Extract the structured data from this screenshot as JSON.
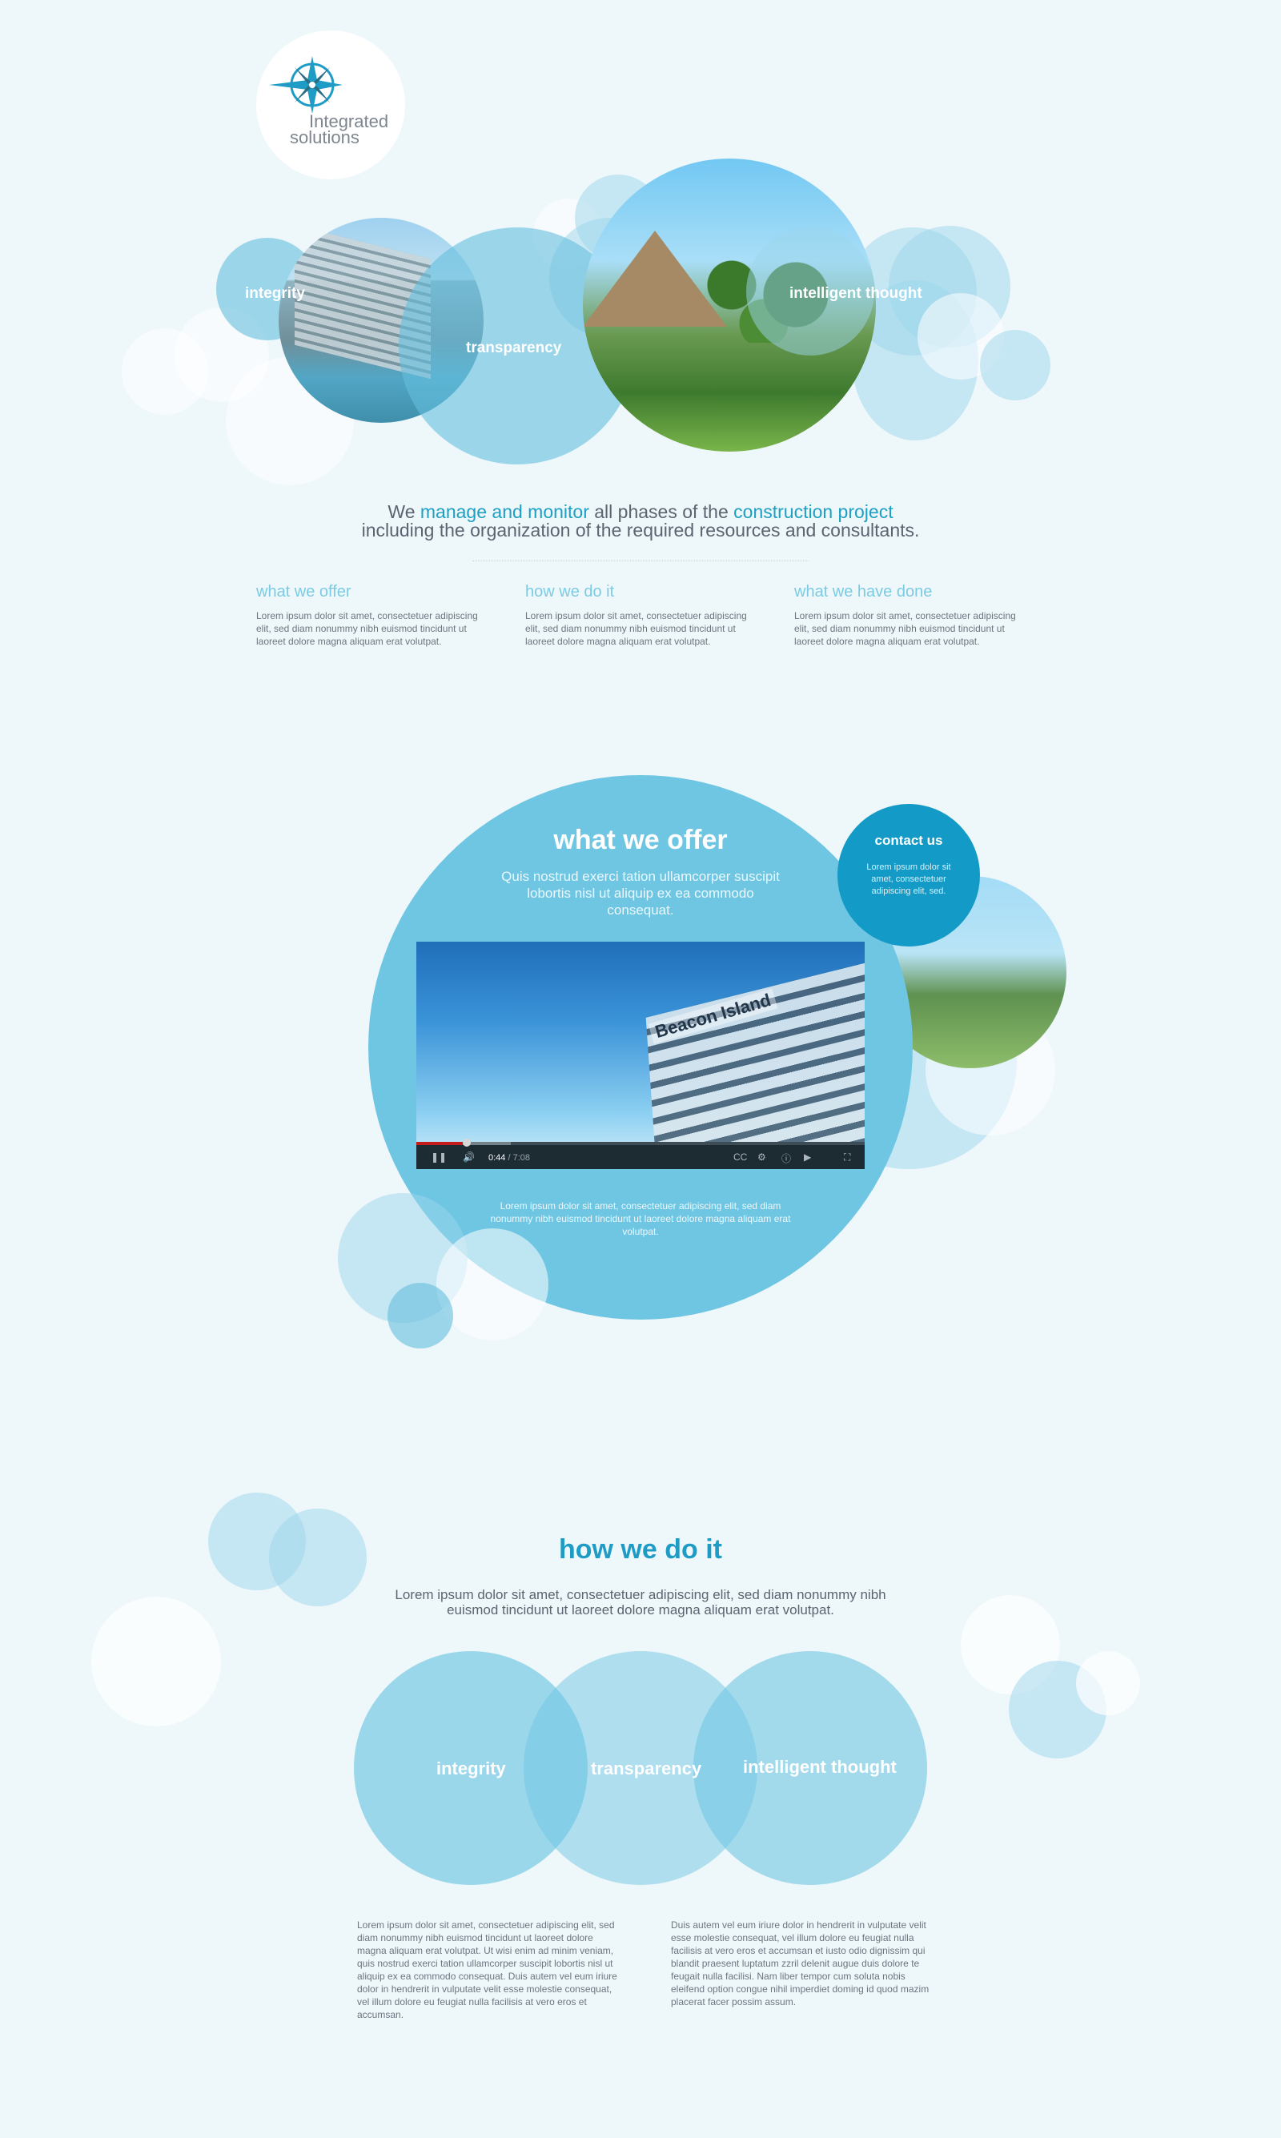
{
  "brand": {
    "name_line1": "Integrated",
    "name_line2": "solutions",
    "logo_icon": "compass-rose-icon"
  },
  "hero": {
    "labels": {
      "integrity": "integrity",
      "transparency": "transparency",
      "intelligent": "intelligent thought"
    },
    "tagline": {
      "p1": "We ",
      "h1": "manage and monitor",
      "p2": " all phases of the ",
      "h2": "construction project",
      "line2": "including the organization of the required resources and consultants."
    },
    "columns": [
      {
        "title": "what we offer",
        "text": "Lorem ipsum dolor sit amet, consectetuer adipiscing elit, sed diam nonummy nibh euismod tincidunt ut laoreet dolore magna aliquam erat volutpat."
      },
      {
        "title": "how we do it",
        "text": "Lorem ipsum dolor sit amet, consectetuer adipiscing elit, sed diam nonummy nibh euismod tincidunt ut laoreet dolore magna aliquam erat volutpat."
      },
      {
        "title": "what we have done",
        "text": "Lorem ipsum dolor sit amet, consectetuer adipiscing elit, sed diam nonummy nibh euismod tincidunt ut laoreet dolore magna aliquam erat volutpat."
      }
    ]
  },
  "offer": {
    "title": "what we offer",
    "subtitle": "Quis nostrud exerci tation ullamcorper suscipit lobortis nisl ut aliquip ex ea commodo consequat.",
    "video": {
      "sign_text": "Beacon Island",
      "current_time": "0:44",
      "duration": "/ 7:08",
      "progress_fraction": 0.103
    },
    "description": "Lorem ipsum dolor sit amet, consectetuer adipiscing elit, sed diam nonummy nibh euismod tincidunt ut laoreet dolore magna aliquam erat volutpat."
  },
  "contact": {
    "title": "contact us",
    "text": "Lorem ipsum dolor sit amet, consectetuer adipiscing elit, sed."
  },
  "how": {
    "title": "how we do it",
    "subtitle": "Lorem ipsum dolor sit amet, consectetuer adipiscing elit, sed diam nonummy nibh euismod tincidunt ut laoreet dolore magna aliquam erat volutpat.",
    "circles": {
      "a": "integrity",
      "b": "transparency",
      "c": "intelligent thought"
    },
    "text_left": "Lorem ipsum dolor sit amet, consectetuer adipiscing elit, sed diam nonummy nibh euismod tincidunt ut laoreet dolore magna aliquam erat volutpat. Ut wisi enim ad minim veniam, quis nostrud exerci tation ullamcorper suscipit lobortis nisl ut aliquip ex ea commodo consequat. Duis autem vel eum iriure dolor in hendrerit in vulputate velit esse molestie consequat, vel illum dolore eu feugiat nulla facilisis at vero eros et accumsan.",
    "text_right": "Duis autem vel eum iriure dolor in hendrerit in vulputate velit esse molestie consequat, vel illum dolore eu feugiat nulla facilisis at vero eros et accumsan et iusto odio dignissim qui blandit praesent luptatum zzril delenit augue duis dolore te feugait nulla facilisi. Nam liber tempor cum soluta nobis eleifend option congue nihil imperdiet doming id quod mazim placerat facer possim assum."
  },
  "colors": {
    "accent": "#1ea0c4",
    "bubble": "#6fc6e3",
    "contact": "#139ac6",
    "background": "#eef7fa"
  }
}
